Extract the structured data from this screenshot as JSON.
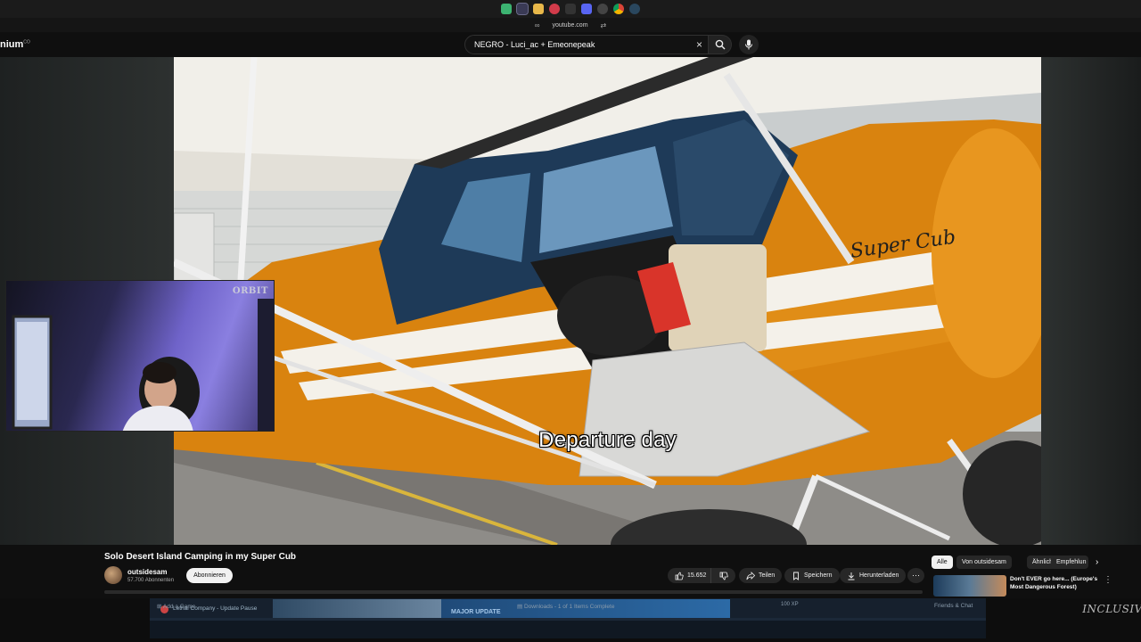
{
  "browser": {
    "url": "youtube.com"
  },
  "header": {
    "logo_fragment": "nium",
    "logo_sup": "CO",
    "search_query": "NEGRO - Luci_ac + Emeonepeak"
  },
  "video": {
    "subtitle": "Departure day",
    "plane_brand": "Super Cub"
  },
  "webcam": {
    "logo": "ORBIT"
  },
  "info": {
    "title": "Solo Desert Island Camping in my Super Cub",
    "channel": "outsidesam",
    "subscribers": "57.700 Abonnenten",
    "subscribe_label": "Abonnieren",
    "likes": "15.652",
    "share_label": "Teilen",
    "save_label": "Speichern",
    "download_label": "Herunterladen"
  },
  "chips": {
    "items": [
      "Alle",
      "Von outsidesam",
      "Ähnlich",
      "Empfehlun"
    ],
    "active": "Alle"
  },
  "recommended": {
    "title": "Don't EVER go here... (Europe's Most Dangerous Forest)"
  },
  "steam": {
    "game": "Lethal Company - Update Pause",
    "banner": "MAJOR UPDATE",
    "xp": "100 XP",
    "add_game": "Add a Game",
    "downloads": "Downloads - 1 of 1 Items Complete",
    "friends": "Friends & Chat"
  },
  "overlay": {
    "corner_logo": "INCLUSIV"
  },
  "colors": {
    "youtube_bg": "#0f0f0f",
    "plane_orange": "#d9830f",
    "steam_bg": "#1b2838"
  }
}
